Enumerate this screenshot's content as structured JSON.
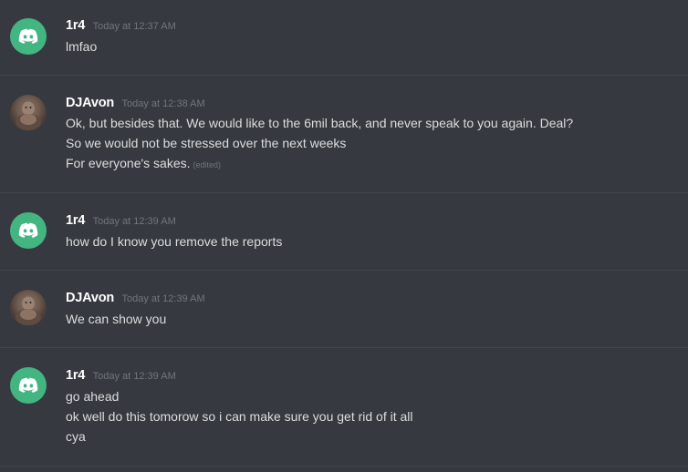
{
  "messages": [
    {
      "author": "1r4",
      "avatar": "discord-logo-icon",
      "timestamp": "Today at 12:37 AM",
      "lines": [
        "lmfao"
      ],
      "edited": ""
    },
    {
      "author": "DJAvon",
      "avatar": "user-photo",
      "timestamp": "Today at 12:38 AM",
      "lines": [
        "Ok, but besides that.  We would like to the 6mil back, and never speak to you again. Deal?",
        "So we would not be stressed over the next weeks",
        "For everyone's sakes."
      ],
      "edited": "(edited)"
    },
    {
      "author": "1r4",
      "avatar": "discord-logo-icon",
      "timestamp": "Today at 12:39 AM",
      "lines": [
        "how do I know you remove the reports"
      ],
      "edited": ""
    },
    {
      "author": "DJAvon",
      "avatar": "user-photo",
      "timestamp": "Today at 12:39 AM",
      "lines": [
        "We can show you"
      ],
      "edited": ""
    },
    {
      "author": "1r4",
      "avatar": "discord-logo-icon",
      "timestamp": "Today at 12:39 AM",
      "lines": [
        "go ahead",
        "ok well do this tomorow so i can make sure you get rid of it all",
        "cya"
      ],
      "edited": ""
    }
  ],
  "colors": {
    "background": "#36393f",
    "username": "#ffffff",
    "message_text": "#dcddde",
    "timestamp": "#72767d",
    "divider": "#42454a",
    "discord_avatar": "#43b581"
  }
}
